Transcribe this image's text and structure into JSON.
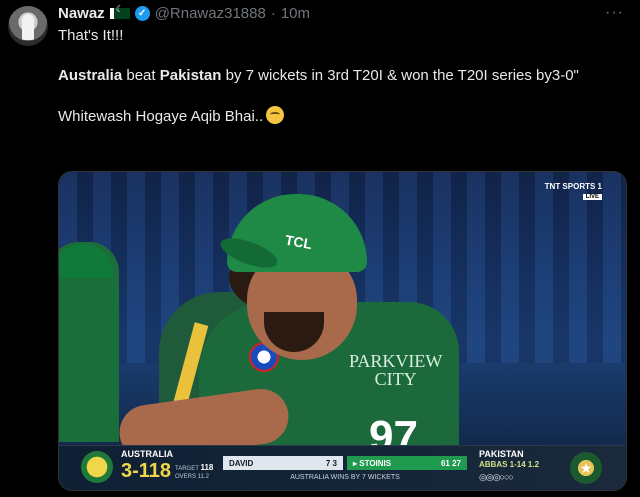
{
  "tweet": {
    "author_name": "Nawaz",
    "handle": "@Rnawaz31888",
    "separator": "·",
    "time": "10m",
    "more": "···",
    "lines": {
      "line1": "That's It!!!",
      "line2_bold1": "Australia",
      "line2_mid1": " beat ",
      "line2_bold2": "Pakistan",
      "line2_rest": " by 7 wickets in 3rd T20I & won the T20I series by3-0\"",
      "line3": "Whitewash Hogaye Aqib Bhai.."
    }
  },
  "media": {
    "broadcaster": "TNT SPORTS 1",
    "broadcaster_badge": "LIVE",
    "cap_text": "TCL",
    "jersey_text_1": "PARKVIEW",
    "jersey_text_2": "CITY",
    "jersey_number": "97",
    "scorebug": {
      "team_left": "AUSTRALIA",
      "team_left_score": "3-118",
      "target_label": "TARGET",
      "target_value": "118",
      "overs_label": "OVERS",
      "overs_value": "11.2",
      "batter1_name": "DAVID",
      "batter1_score": "7 3",
      "batter2_name": "▸ STOINIS",
      "batter2_score": "61 27",
      "result": "AUSTRALIA WINS BY 7 WICKETS",
      "team_right": "PAKISTAN",
      "bowler": "ABBAS 1-14 1.2",
      "balls": "◎◎◎○○○"
    }
  }
}
